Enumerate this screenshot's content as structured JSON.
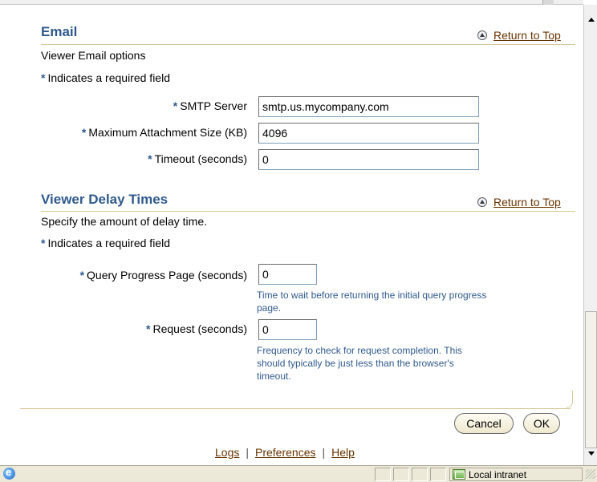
{
  "email_section": {
    "title": "Email",
    "return_to_top": "Return to Top",
    "description": "Viewer Email options",
    "required_note": "Indicates a required field",
    "required_marker": "*",
    "fields": {
      "smtp_label": "SMTP Server",
      "smtp_value": "smtp.us.mycompany.com",
      "max_attach_label": "Maximum Attachment Size (KB)",
      "max_attach_value": "4096",
      "timeout_label": "Timeout (seconds)",
      "timeout_value": "0"
    }
  },
  "delay_section": {
    "title": "Viewer Delay Times",
    "return_to_top": "Return to Top",
    "description": "Specify the amount of delay time.",
    "required_note": "Indicates a required field",
    "required_marker": "*",
    "fields": {
      "query_progress_label": "Query Progress Page (seconds)",
      "query_progress_value": "0",
      "query_progress_tip": "Time to wait before returning the initial query progress page.",
      "request_label": "Request (seconds)",
      "request_value": "0",
      "request_tip": "Frequency to check for request completion. This should typically be just less than the browser's timeout."
    }
  },
  "buttons": {
    "cancel": "Cancel",
    "ok": "OK"
  },
  "footer": {
    "logs": "Logs",
    "preferences": "Preferences",
    "help": "Help",
    "separator": "|"
  },
  "statusbar": {
    "zone_label": "Local intranet"
  },
  "colors": {
    "section_title": "#2f5a8c",
    "link": "#663300",
    "rule": "#d6c89a",
    "tip_text": "#2f5a8c"
  },
  "icons": {
    "return_to_top": "up-arrow-circle-icon",
    "status_page": "ie-page-icon",
    "zone": "local-intranet-icon"
  }
}
